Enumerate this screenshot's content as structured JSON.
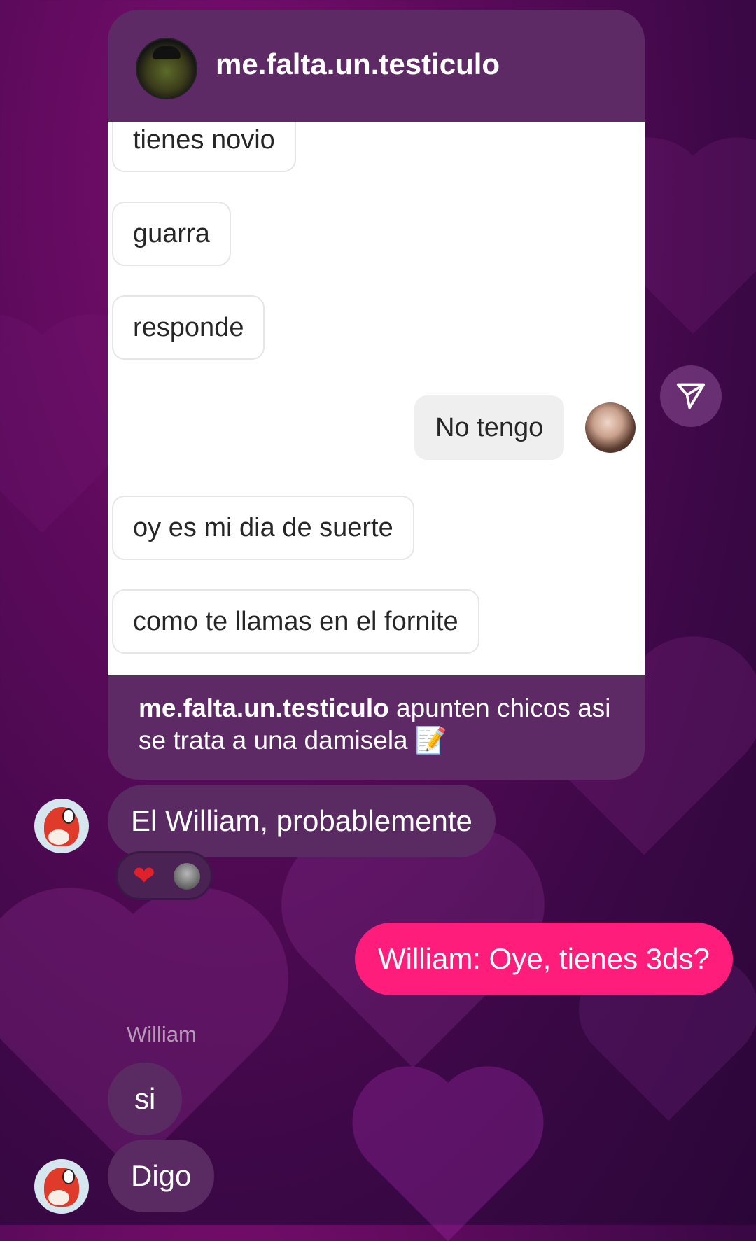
{
  "shared_post": {
    "username": "me.falta.un.testiculo",
    "screenshot_messages": [
      {
        "text": "tienes novio",
        "side": "received"
      },
      {
        "text": "guarra",
        "side": "received"
      },
      {
        "text": "responde",
        "side": "received"
      },
      {
        "text": "No tengo",
        "side": "sent"
      },
      {
        "text": "oy es mi dia de suerte",
        "side": "received"
      },
      {
        "text": "como te llamas en el fornite",
        "side": "received"
      }
    ],
    "caption_username": "me.falta.un.testiculo",
    "caption_text": "apunten chicos asi se trata a una damisela 📝"
  },
  "chat": {
    "messages": [
      {
        "text": "El William, probablemente",
        "side": "received"
      },
      {
        "text": "William: Oye, tienes 3ds?",
        "side": "sent"
      },
      {
        "text": "si",
        "side": "received"
      },
      {
        "text": "Digo",
        "side": "received"
      }
    ],
    "reaction": {
      "emoji": "❤"
    },
    "sender_label": "William"
  },
  "icons": {
    "share": "paper-plane-icon"
  },
  "colors": {
    "sent_bubble": "#ff1d7c",
    "received_bubble": "#5a2a63",
    "card": "#5e2a66"
  }
}
